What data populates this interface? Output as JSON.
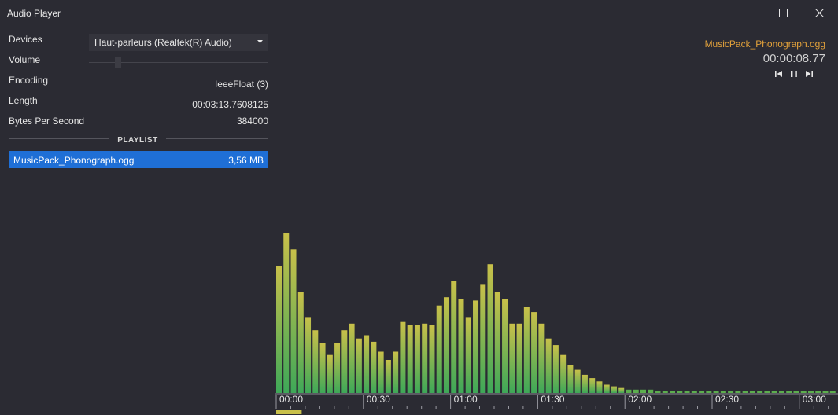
{
  "window": {
    "title": "Audio Player",
    "icons": [
      "minimize-icon",
      "maximize-icon",
      "close-icon"
    ]
  },
  "info": {
    "devices_label": "Devices",
    "device_value": "Haut-parleurs (Realtek(R) Audio)",
    "volume_label": "Volume",
    "volume_level": 0.15,
    "encoding_label": "Encoding",
    "encoding_value": "IeeeFloat (3)",
    "length_label": "Length",
    "length_value": "00:03:13.7608125",
    "bps_label": "Bytes Per Second",
    "bps_value": "384000"
  },
  "playlist": {
    "header": "PLAYLIST",
    "items": [
      {
        "name": "MusicPack_Phonograph.ogg",
        "size": "3,56 MB",
        "selected": true
      }
    ]
  },
  "now_playing": {
    "file": "MusicPack_Phonograph.ogg",
    "time": "00:00:08.77",
    "controls": [
      "previous-icon",
      "pause-icon",
      "next-icon"
    ]
  },
  "colors": {
    "accent": "#1f6fd6",
    "file_name": "#e3a23b",
    "bar_top": "#c8c04a",
    "bar_bottom": "#3ea858",
    "progress": "#c8c04a"
  },
  "spectrum": {
    "levels": [
      0.77,
      0.97,
      0.87,
      0.61,
      0.46,
      0.38,
      0.3,
      0.23,
      0.3,
      0.38,
      0.42,
      0.33,
      0.35,
      0.31,
      0.25,
      0.2,
      0.25,
      0.43,
      0.41,
      0.41,
      0.42,
      0.41,
      0.53,
      0.58,
      0.68,
      0.57,
      0.46,
      0.56,
      0.66,
      0.78,
      0.61,
      0.57,
      0.42,
      0.42,
      0.52,
      0.49,
      0.42,
      0.33,
      0.29,
      0.23,
      0.17,
      0.14,
      0.11,
      0.09,
      0.07,
      0.05,
      0.04,
      0.03,
      0.02,
      0.02,
      0.02,
      0.02,
      0.01,
      0.01,
      0.01,
      0.01,
      0.01,
      0.01,
      0.01,
      0.01,
      0.01,
      0.01,
      0.01,
      0.01,
      0.01,
      0.01,
      0.01,
      0.01,
      0.01,
      0.01,
      0.01,
      0.01,
      0.01,
      0.01,
      0.01,
      0.01,
      0.01
    ],
    "tick_labels": [
      "00:00",
      "00:30",
      "01:00",
      "01:30",
      "02:00",
      "02:30",
      "03:00"
    ],
    "duration_seconds": 193.76,
    "position_seconds": 8.77
  }
}
